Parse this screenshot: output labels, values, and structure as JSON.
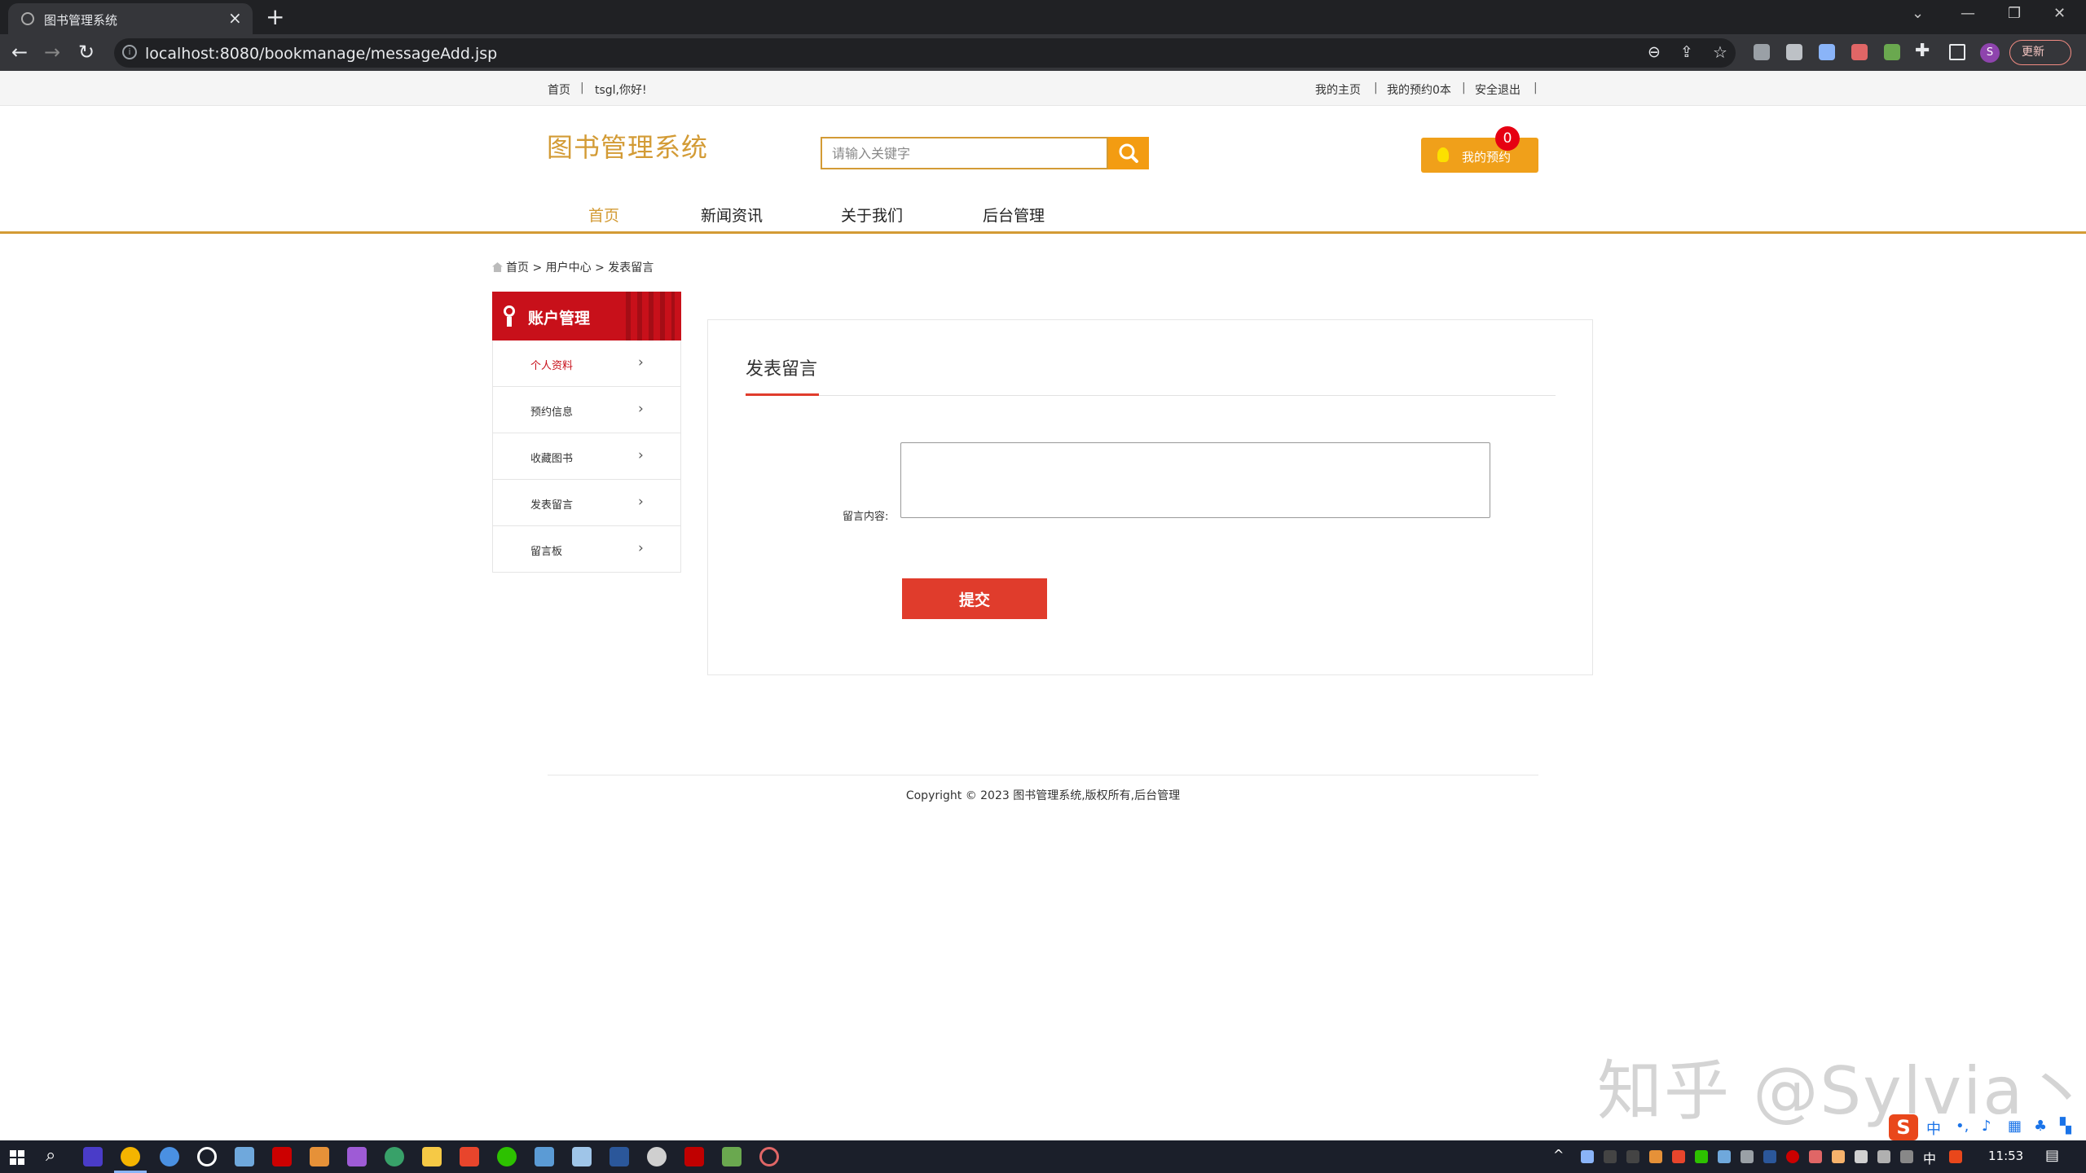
{
  "browser": {
    "tab_title": "图书管理系统",
    "tab_close": "×",
    "new_tab": "+",
    "url": "localhost:8080/bookmanage/messageAdd.jsp",
    "profile_initial": "S",
    "update_label": "更新"
  },
  "topbar": {
    "home": "首页",
    "greeting": "tsgl,你好!",
    "my_home": "我的主页",
    "my_reservation": "我的预约0本",
    "logout": "安全退出",
    "separator": "|"
  },
  "header": {
    "logo": "图书管理系统",
    "search_placeholder": "请输入关键字",
    "my_reservation_button": "我的预约",
    "reservation_count": "0"
  },
  "nav": {
    "items": [
      "首页",
      "新闻资讯",
      "关于我们",
      "后台管理"
    ],
    "active_index": 0
  },
  "breadcrumb": {
    "home": "首页",
    "user_center": "用户中心",
    "current": "发表留言",
    "sep": ">"
  },
  "sidebar": {
    "title": "账户管理",
    "items": [
      {
        "label": "个人资料"
      },
      {
        "label": "预约信息"
      },
      {
        "label": "收藏图书"
      },
      {
        "label": "发表留言"
      },
      {
        "label": "留言板"
      }
    ],
    "active_index": 0
  },
  "form": {
    "title": "发表留言",
    "label": "留言内容:",
    "value": "",
    "submit": "提交"
  },
  "footer": {
    "copyright": "Copyright © 2023 图书管理系统,版权所有,后台管理"
  },
  "watermark": "知乎 @Sylvia丶",
  "taskbar": {
    "time": "11:53",
    "ime_lang": "中"
  },
  "colors": {
    "brand_gold": "#d39b35",
    "sidebar_red": "#c8101a",
    "submit_red": "#e03c2c",
    "search_orange": "#f39c12"
  }
}
